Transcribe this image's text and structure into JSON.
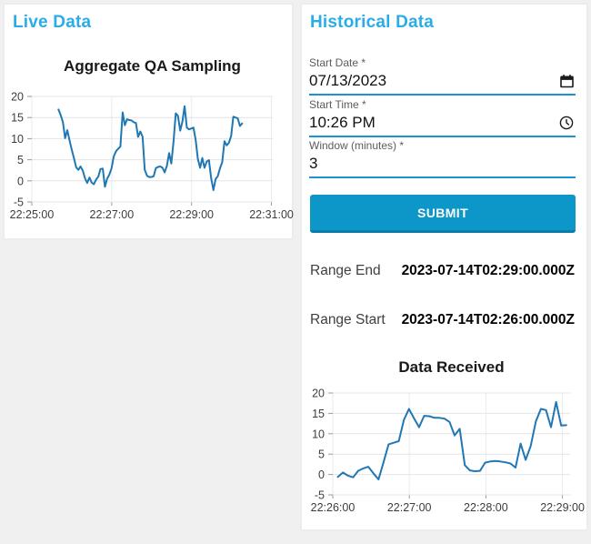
{
  "colors": {
    "heading_accent": "#2aace8",
    "field_underline": "#1a93d6",
    "submit_button": "#0d96c8",
    "chart_line": "#2077b4",
    "page_background": "#f0f0f0"
  },
  "live_panel": {
    "title": "Live Data"
  },
  "historical_panel": {
    "title": "Historical Data",
    "fields": [
      {
        "label": "Start Date *",
        "value": "07/13/2023",
        "icon": "calendar-icon"
      },
      {
        "label": "Start Time *",
        "value": "10:26 PM",
        "icon": "clock-icon"
      },
      {
        "label": "Window (minutes) *",
        "value": "3",
        "icon": null
      }
    ],
    "submit_label": "SUBMIT",
    "range_end": {
      "label": "Range End",
      "value": "2023-07-14T02:29:00.000Z"
    },
    "range_start": {
      "label": "Range Start",
      "value": "2023-07-14T02:26:00.000Z"
    }
  },
  "chart_data": [
    {
      "id": "aggregate-qa-sampling",
      "type": "line",
      "title": "Aggregate QA Sampling",
      "xlabel": "",
      "ylabel": "",
      "x_unit": "seconds after 22:25:00",
      "x_tick_labels": [
        "22:25:00",
        "22:27:00",
        "22:29:00",
        "22:31:00"
      ],
      "x_tick_seconds": [
        0,
        120,
        240,
        360
      ],
      "x_domain_seconds": [
        0,
        362
      ],
      "y_ticks": [
        20,
        15,
        10,
        5,
        0,
        -5
      ],
      "ylim": [
        -5,
        20
      ],
      "grid": true,
      "legend": "none",
      "line_color": "#2077b4",
      "series": [
        {
          "name": "aggregate_qa_sampling",
          "t_start": 40,
          "t_end": 316,
          "values": [
            16.9,
            15.6,
            13.9,
            10.1,
            12.0,
            9.6,
            7.4,
            5.4,
            3.2,
            2.6,
            3.4,
            2.4,
            0.6,
            -0.5,
            0.8,
            -0.4,
            -0.8,
            0.3,
            1.0,
            2.8,
            2.9,
            -1.4,
            0.5,
            1.5,
            3.0,
            5.8,
            7.0,
            7.6,
            8.1,
            16.2,
            13.2,
            14.6,
            14.4,
            14.3,
            13.9,
            13.7,
            10.4,
            11.7,
            10.5,
            2.6,
            1.2,
            0.9,
            0.9,
            1.1,
            3.0,
            3.3,
            3.4,
            3.1,
            2.0,
            3.6,
            6.6,
            4.1,
            9.4,
            16.0,
            15.4,
            11.9,
            14.0,
            17.7,
            12.6,
            12.2,
            12.4,
            12.6,
            9.7,
            5.2,
            3.1,
            5.4,
            3.1,
            4.6,
            4.9,
            0.7,
            -2.2,
            0.4,
            1.1,
            3.0,
            4.4,
            9.4,
            8.4,
            9.0,
            10.6,
            15.2,
            15.0,
            14.8,
            13.0,
            13.6
          ]
        }
      ]
    },
    {
      "id": "data-received",
      "type": "line",
      "title": "Data Received",
      "xlabel": "",
      "ylabel": "",
      "x_unit": "seconds after 22:26:00",
      "x_tick_labels": [
        "22:26:00",
        "22:27:00",
        "22:28:00",
        "22:29:00"
      ],
      "x_tick_seconds": [
        0,
        60,
        120,
        180
      ],
      "x_domain_seconds": [
        0,
        186
      ],
      "y_ticks": [
        20,
        15,
        10,
        5,
        0,
        -5
      ],
      "ylim": [
        -5,
        20
      ],
      "grid": true,
      "legend": "none",
      "line_color": "#2077b4",
      "series": [
        {
          "name": "data_received",
          "t_start": 4,
          "t_end": 183,
          "values": [
            -0.6,
            0.5,
            -0.3,
            -0.7,
            0.9,
            1.5,
            1.9,
            0.3,
            -1.2,
            3.0,
            7.4,
            7.8,
            8.2,
            13.4,
            16.1,
            13.8,
            11.6,
            14.4,
            14.3,
            13.9,
            13.9,
            13.7,
            12.9,
            9.6,
            11.2,
            2.3,
            1.0,
            0.8,
            0.9,
            2.9,
            3.2,
            3.3,
            3.2,
            3.0,
            2.7,
            1.7,
            7.6,
            3.6,
            7.0,
            13.0,
            16.1,
            15.8,
            11.6,
            17.8,
            12.0,
            12.1
          ]
        }
      ]
    }
  ]
}
